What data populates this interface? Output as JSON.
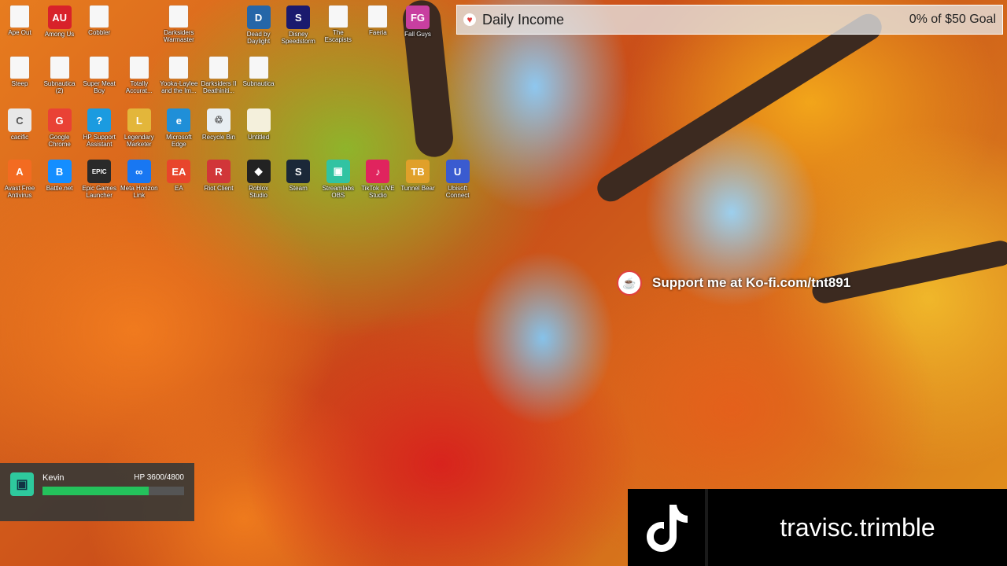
{
  "desktop_icons": [
    {
      "label": "Ape Out",
      "color": "#ffffff",
      "glyph": ""
    },
    {
      "label": "Among Us",
      "color": "#d8222a",
      "glyph": "AU"
    },
    {
      "label": "Cobbler",
      "color": "#ffffff",
      "glyph": ""
    },
    {
      "label": "Darksiders\nWarmaster",
      "color": "#ffffff",
      "glyph": ""
    },
    {
      "label": "Dead by\nDaylight",
      "color": "#2566a8",
      "glyph": "D"
    },
    {
      "label": "Disney\nSpeedstorm",
      "color": "#1a1a6e",
      "glyph": "S"
    },
    {
      "label": "The Escapists",
      "color": "#ffffff",
      "glyph": ""
    },
    {
      "label": "Faeria",
      "color": "#ffffff",
      "glyph": ""
    },
    {
      "label": "Fall Guys",
      "color": "#c83fa0",
      "glyph": "FG"
    },
    {
      "label": "Steep",
      "color": "#ffffff",
      "glyph": ""
    },
    {
      "label": "Subnautica\n(2)",
      "color": "#ffffff",
      "glyph": ""
    },
    {
      "label": "Super Meat\nBoy",
      "color": "#ffffff",
      "glyph": ""
    },
    {
      "label": "Totally\nAccurat...",
      "color": "#ffffff",
      "glyph": ""
    },
    {
      "label": "Yooka-Laylee\nand the Im...",
      "color": "#ffffff",
      "glyph": ""
    },
    {
      "label": "Darksiders II\nDeathiniti...",
      "color": "#ffffff",
      "glyph": ""
    },
    {
      "label": "Subnautica",
      "color": "#ffffff",
      "glyph": ""
    },
    {
      "label": "cacific",
      "color": "#e8e8e8",
      "glyph": "C"
    },
    {
      "label": "Google\nChrome",
      "color": "#e94235",
      "glyph": "G"
    },
    {
      "label": "HP Support\nAssistant",
      "color": "#1b9be0",
      "glyph": "?"
    },
    {
      "label": "Legendary\nMarketer",
      "color": "#e3b63a",
      "glyph": "L"
    },
    {
      "label": "Microsoft\nEdge",
      "color": "#1f8fd8",
      "glyph": "e"
    },
    {
      "label": "Recycle Bin",
      "color": "#e8eef2",
      "glyph": "♲"
    },
    {
      "label": "Untitled",
      "color": "#f4f0dc",
      "glyph": ""
    },
    {
      "label": "Avast Free\nAntivirus",
      "color": "#f36b21",
      "glyph": "A"
    },
    {
      "label": "Battle.net",
      "color": "#148eff",
      "glyph": "B"
    },
    {
      "label": "Epic Games\nLauncher",
      "color": "#2a2a2a",
      "glyph": "EPIC"
    },
    {
      "label": "Meta Horizon\nLink",
      "color": "#1877f2",
      "glyph": "∞"
    },
    {
      "label": "EA",
      "color": "#e8452c",
      "glyph": "EA"
    },
    {
      "label": "Riot Client",
      "color": "#d13639",
      "glyph": "R"
    },
    {
      "label": "Roblox\nStudio",
      "color": "#222222",
      "glyph": "◆"
    },
    {
      "label": "Steam",
      "color": "#1b2838",
      "glyph": "S"
    },
    {
      "label": "Streamlabs\nOBS",
      "color": "#31c3a2",
      "glyph": "▣"
    },
    {
      "label": "TikTok LIVE\nStudio",
      "color": "#e0245e",
      "glyph": "♪"
    },
    {
      "label": "Tunnel Bear",
      "color": "#e0a02a",
      "glyph": "TB"
    },
    {
      "label": "Ubisoft\nConnect",
      "color": "#3a5bd0",
      "glyph": "U"
    }
  ],
  "income_widget": {
    "title": "Daily Income",
    "goal_text": "0% of $50 Goal",
    "progress_fraction": 0
  },
  "kofi_banner": {
    "text": "Support me at Ko-fi.com/tnt891"
  },
  "hp_widget": {
    "name": "Kevin",
    "hp_text": "HP 3600/4800",
    "hp_fraction": 0.75,
    "bar_color": "#24c25c"
  },
  "tiktok_banner": {
    "handle": "travisc.trimble",
    "icon": "tiktok-icon"
  }
}
